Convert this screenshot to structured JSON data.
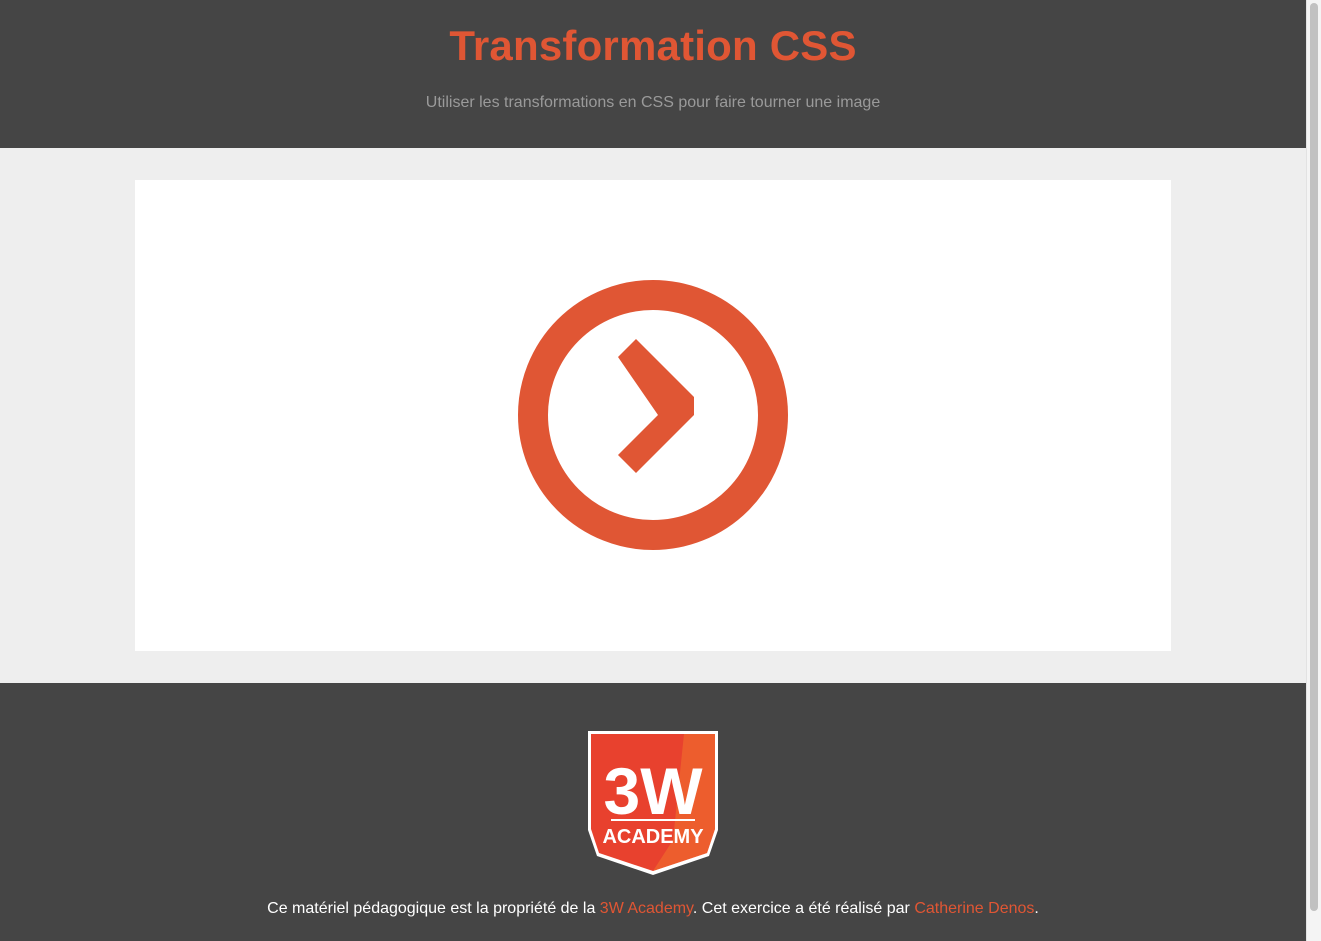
{
  "header": {
    "title": "Transformation CSS",
    "subtitle": "Utiliser les transformations en CSS pour faire tourner une image"
  },
  "main": {
    "image_icon": "chevron-right-circle-icon",
    "accent_color": "#e05634"
  },
  "footer": {
    "logo": {
      "line1": "3W",
      "line2": "ACADEMY",
      "color": "#e8412e"
    },
    "credit": {
      "prefix": "Ce matériel pédagogique est la propriété de la ",
      "org_link": "3W Academy",
      "middle": ". Cet exercice a été réalisé par ",
      "author_link": "Catherine Denos",
      "suffix": "."
    }
  },
  "colors": {
    "dark_bg": "#454545",
    "light_bg": "#eeeeee",
    "subtitle": "#9a9a9a"
  }
}
